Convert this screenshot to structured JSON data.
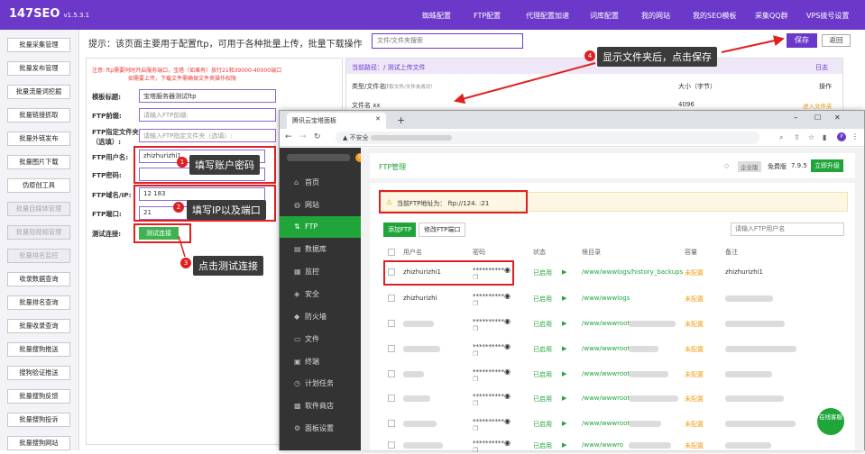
{
  "app": {
    "logo": "147SEO",
    "version": "v1.5.3.1"
  },
  "topnav": [
    "蜘蛛配置",
    "FTP配置",
    "代理配置加速",
    "词库配置",
    "我的网站",
    "我的SEO模板",
    "采集QQ群",
    "VPS拨号设置"
  ],
  "sidebar": [
    "批量采集管理",
    "批量发布管理",
    "批量流量词挖掘",
    "批量链接抓取",
    "批量外链发布",
    "批量图片下载",
    "伪原创工具",
    "批量自媒体管理",
    "批量短视频管理",
    "批量排名监控",
    "收录数据查询",
    "批量排名查询",
    "批量收录查询",
    "批量搜狗推送",
    "搜狗验证推送",
    "批量搜狗反馈",
    "批量搜狗投诉",
    "批量搜狗网站"
  ],
  "hint": "提示：该页面主要用于配置ftp，可用于各种批量上传，批量下载操作",
  "file_search_placeholder": "文件/文件夹搜索",
  "save_button": "保存",
  "back_button": "返回",
  "notice_line1": "注意: ftp需要同时开启服务端口，宝塔（如果有）放行21和39000-40000端口",
  "notice_line2": "如需要上传，下载文件需确保文件夹操作权限",
  "form": {
    "template_label": "模板标题:",
    "template_value": "宝塔服务器测试ftp",
    "ftp_prefix_label": "FTP前缀:",
    "ftp_prefix_placeholder": "请输入FTP前缀:",
    "ftp_folder_label": "FTP指定文件夹（选填）:",
    "ftp_folder_placeholder": "请输入FTP指定文件夹（选填）:",
    "ftp_user_label": "FTP用户名:",
    "ftp_user_value": "zhizhurizhi1",
    "ftp_pass_label": "FTP密码:",
    "ftp_domain_label": "FTP域名/IP:",
    "ftp_domain_value": "12          183",
    "ftp_port_label": "FTP端口:",
    "ftp_port_value": "21",
    "test_label": "测试连接:",
    "test_button": "测试连接"
  },
  "filepanel": {
    "path_label": "当前路径：/ 测试上传文件",
    "path_right": "日志",
    "col_type": "类型/文件名",
    "col_type_note": "获取文件/文件夹成功！",
    "col_size": "大小（字节）",
    "col_op": "操作",
    "row_name": "文件名  xx",
    "row_size": "4096",
    "row_op": "进入文件夹"
  },
  "annotations": {
    "a1": "填写账户密码",
    "a2": "填写IP以及端口",
    "a3": "点击测试连接",
    "a4": "显示文件夹后，点击保存"
  },
  "browser": {
    "tab_title": "腾讯云宝塔面板",
    "insecure": "不安全",
    "url": ""
  },
  "bt": {
    "menu": [
      "首页",
      "网站",
      "FTP",
      "数据库",
      "监控",
      "安全",
      "防火墙",
      "文件",
      "终端",
      "计划任务",
      "软件商店",
      "面板设置"
    ],
    "tab": "FTP管理",
    "enterprise": "企业版",
    "free": "免费版",
    "version": "7.9.5",
    "upgrade": "立即升级",
    "ftp_addr": "当前FTP地址为： ftp://124.        :21",
    "add_ftp": "添加FTP",
    "change_port": "修改FTP端口",
    "search_placeholder": "请输入FTP用户名",
    "headers": [
      "用户名",
      "密码",
      "状态",
      "根目录",
      "容量",
      "备注"
    ],
    "rows": [
      {
        "user": "zhizhurizhi1",
        "pass": "**********",
        "status": "已启用",
        "root": "/www/wwwlogs/history_backups",
        "cap": "未配置",
        "note": "zhizhurizhi1"
      },
      {
        "user": "zhizhurizhi",
        "pass": "**********",
        "status": "已启用",
        "root": "/www/wwwlogs",
        "cap": "未配置",
        "note": ""
      },
      {
        "user": "",
        "pass": "**********",
        "status": "已启用",
        "root": "/www/wwwroot",
        "cap": "未配置",
        "note": ""
      },
      {
        "user": "",
        "pass": "**********",
        "status": "已启用",
        "root": "/www/wwwroot",
        "cap": "未配置",
        "note": ""
      },
      {
        "user": "",
        "pass": "**********",
        "status": "已启用",
        "root": "/www/wwwroot",
        "cap": "未配置",
        "note": ""
      },
      {
        "user": "",
        "pass": "**********",
        "status": "已启用",
        "root": "/www/wwwroot",
        "cap": "未配置",
        "note": ""
      },
      {
        "user": "",
        "pass": "**********",
        "status": "已启用",
        "root": "/www/wwwroot",
        "cap": "未配置",
        "note": ""
      },
      {
        "user": "",
        "pass": "**********",
        "status": "已启用",
        "root": "/www/wwwro",
        "cap": "未配置",
        "note": ""
      }
    ],
    "chat": "在线客服"
  },
  "colors": {
    "brand": "#6c38c9",
    "annotation": "#e02020",
    "bt_green": "#20a53a"
  }
}
